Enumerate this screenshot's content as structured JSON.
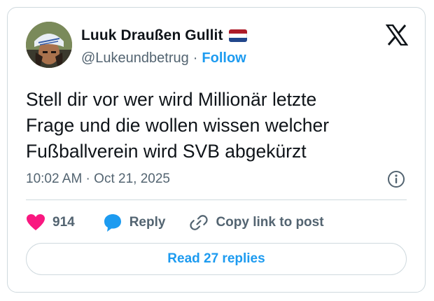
{
  "author": {
    "display_name": "Luuk Draußen Gullit",
    "handle": "@Lukeundbetrug",
    "separator": "·",
    "follow_label": "Follow",
    "flag_colors": [
      "#ae1c28",
      "#ffffff",
      "#21468b"
    ]
  },
  "tweet": {
    "text": "Stell dir vor wer wird Millionär letzte\nFrage und die wollen wissen welcher\nFußballverein wird SVB abgekürzt",
    "timestamp": "10:02 AM · Oct 21, 2025"
  },
  "actions": {
    "likes_count": "914",
    "reply_label": "Reply",
    "copy_label": "Copy link to post",
    "read_replies_label": "Read 27 replies"
  },
  "icons": {
    "brand": "x-logo-icon",
    "info": "info-icon",
    "like": "heart-icon",
    "reply": "speech-bubble-icon",
    "copy": "link-icon"
  },
  "colors": {
    "accent": "#1d9bf0",
    "heart": "#f91880",
    "text_primary": "#0f1419",
    "text_secondary": "#536471",
    "border": "#cfd9de"
  }
}
